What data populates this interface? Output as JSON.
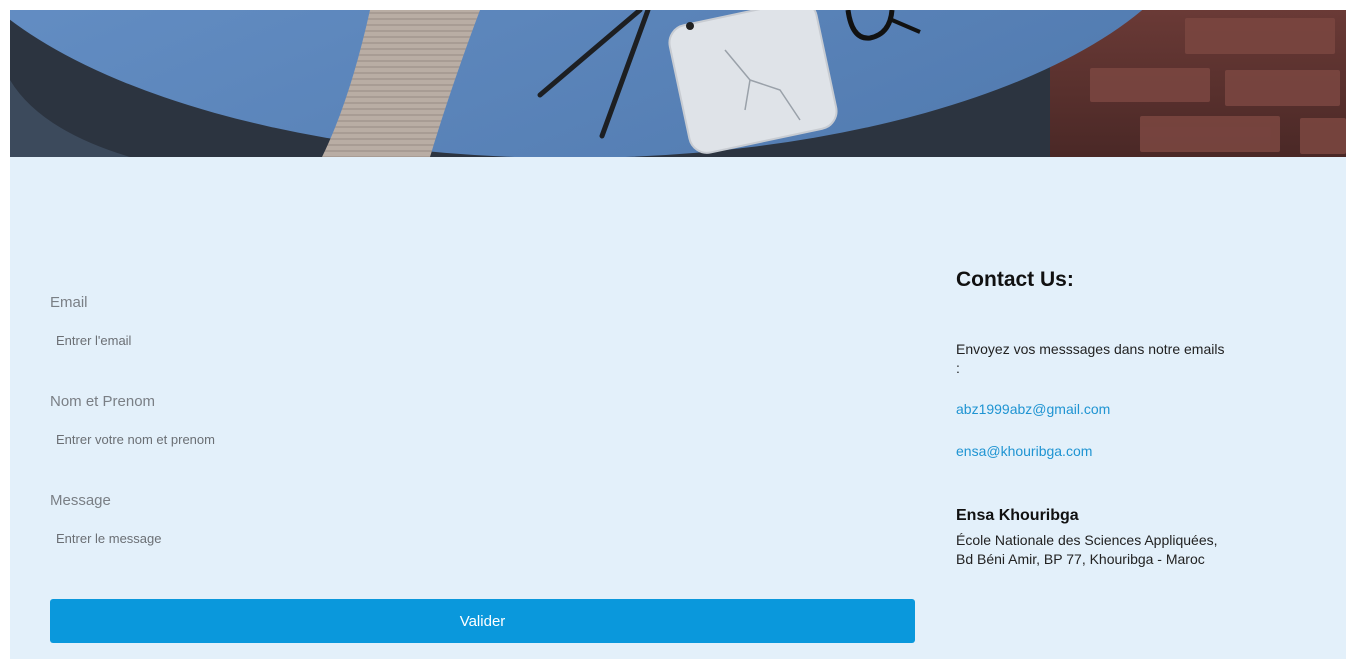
{
  "form": {
    "email_label": "Email",
    "email_placeholder": "Entrer l'email",
    "name_label": "Nom et Prenom",
    "name_placeholder": "Entrer votre nom et prenom",
    "message_label": "Message",
    "message_placeholder": "Entrer le message",
    "submit_label": "Valider"
  },
  "contact": {
    "title": "Contact Us:",
    "intro": "Envoyez vos messsages dans notre emails :",
    "emails": [
      "abz1999abz@gmail.com",
      "ensa@khouribga.com"
    ],
    "org_name": "Ensa Khouribga",
    "address_line1": "École Nationale des Sciences Appliquées,",
    "address_line2": "Bd Béni Amir, BP 77, Khouribga - Maroc"
  },
  "colors": {
    "content_bg": "#e3f0fa",
    "button_bg": "#0a98dc",
    "link": "#1f94d2"
  }
}
